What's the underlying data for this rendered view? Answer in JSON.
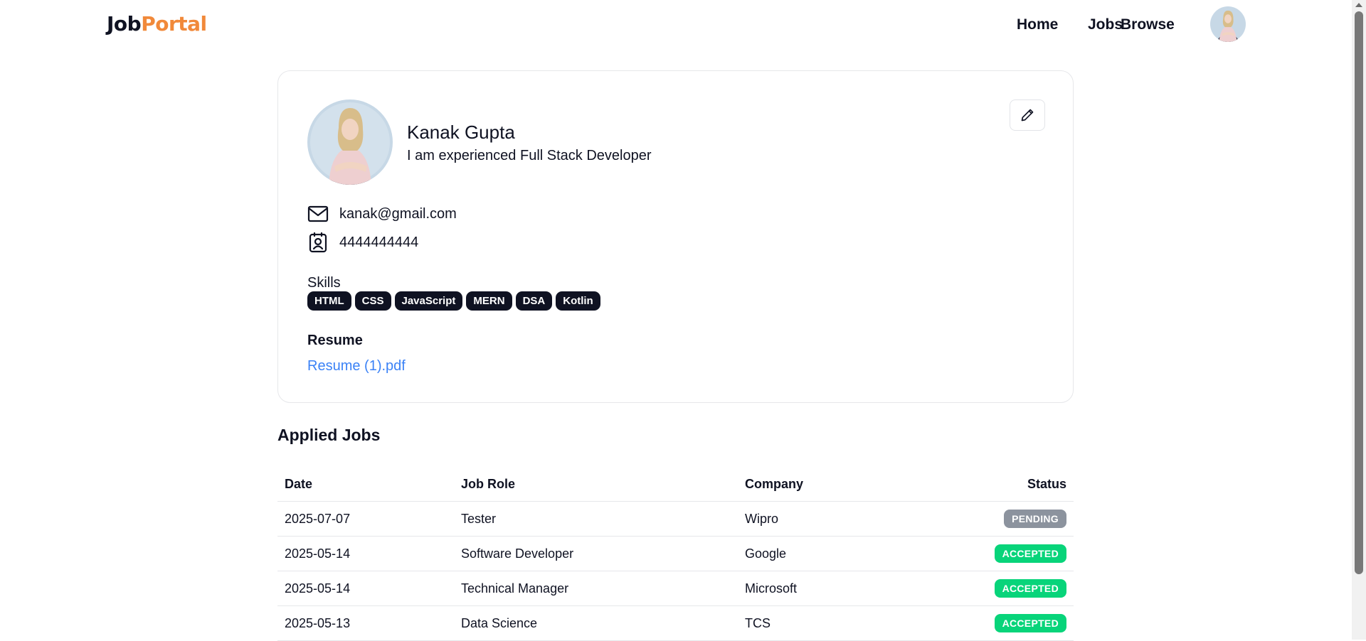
{
  "navbar": {
    "logo_part1": "Job",
    "logo_part2": "Portal",
    "links": [
      "Home",
      "Jobs",
      "Browse"
    ]
  },
  "profile": {
    "name": "Kanak Gupta",
    "bio": "I am experienced Full Stack Developer",
    "email": "kanak@gmail.com",
    "phone": "4444444444",
    "skills_label": "Skills",
    "skills": [
      "HTML",
      "CSS",
      "JavaScript",
      "MERN",
      "DSA",
      "Kotlin"
    ],
    "resume_label": "Resume",
    "resume_file": "Resume (1).pdf"
  },
  "applied_jobs": {
    "title": "Applied Jobs",
    "columns": [
      "Date",
      "Job Role",
      "Company",
      "Status"
    ],
    "rows": [
      {
        "date": "2025-07-07",
        "role": "Tester",
        "company": "Wipro",
        "status": "PENDING"
      },
      {
        "date": "2025-05-14",
        "role": "Software Developer",
        "company": "Google",
        "status": "ACCEPTED"
      },
      {
        "date": "2025-05-14",
        "role": "Technical Manager",
        "company": "Microsoft",
        "status": "ACCEPTED"
      },
      {
        "date": "2025-05-13",
        "role": "Data Science",
        "company": "TCS",
        "status": "ACCEPTED"
      }
    ]
  },
  "colors": {
    "brand_dark": "#0f1222",
    "brand_accent": "#f1893a",
    "link": "#3b82f6",
    "status_pending": "#8c939e",
    "status_accepted": "#08d47a"
  },
  "icons": [
    "avatar-photo",
    "pencil-icon",
    "mail-icon",
    "contact-card-icon"
  ]
}
